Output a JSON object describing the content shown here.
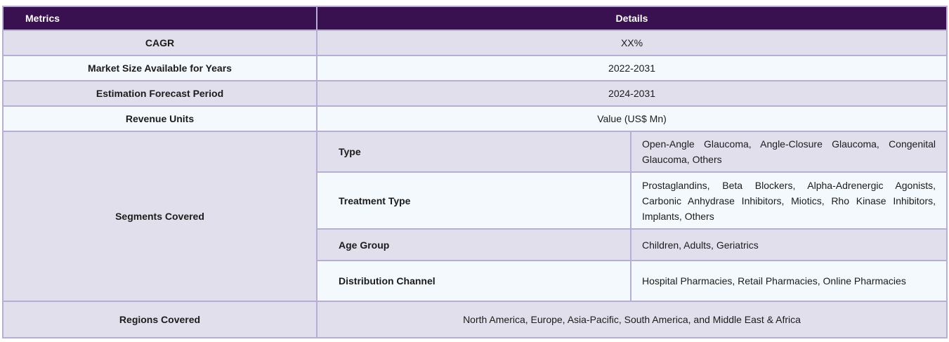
{
  "header": {
    "metrics": "Metrics",
    "details": "Details"
  },
  "rows": {
    "cagr": {
      "label": "CAGR",
      "value": "XX%"
    },
    "market_size": {
      "label": "Market Size Available for Years",
      "value": "2022-2031"
    },
    "forecast": {
      "label": "Estimation Forecast Period",
      "value": "2024-2031"
    },
    "revenue": {
      "label": "Revenue Units",
      "value": "Value (US$ Mn)"
    }
  },
  "segments": {
    "label": "Segments Covered",
    "items": [
      {
        "name": "Type",
        "value": "Open-Angle Glaucoma, Angle-Closure Glaucoma, Congenital Glaucoma, Others"
      },
      {
        "name": "Treatment Type",
        "value": "Prostaglandins, Beta Blockers, Alpha-Adrenergic Agonists, Carbonic Anhydrase Inhibitors, Miotics, Rho Kinase Inhibitors, Implants, Others"
      },
      {
        "name": "Age Group",
        "value": "Children, Adults, Geriatrics"
      },
      {
        "name": "Distribution Channel",
        "value": "Hospital Pharmacies, Retail Pharmacies, Online Pharmacies"
      }
    ]
  },
  "regions": {
    "label": "Regions Covered",
    "value": "North America, Europe, Asia-Pacific, South America, and Middle East & Africa"
  },
  "colors": {
    "header_bg": "#3a1150",
    "row_lavender": "#e2dfec",
    "row_white": "#f4f9fd",
    "border": "#b7aed6"
  }
}
